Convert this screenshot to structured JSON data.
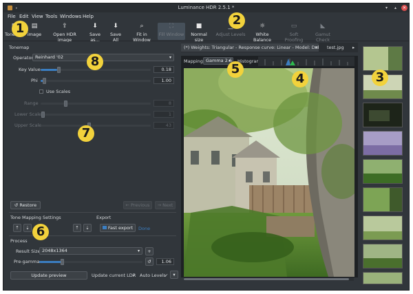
{
  "app": {
    "title": "Luminance HDR 2.5.1 *"
  },
  "menu": [
    "File",
    "Edit",
    "View",
    "Tools",
    "Windows",
    "Help"
  ],
  "toolbar": [
    {
      "label": "Tonemap",
      "icon": "tonemap-icon",
      "enabled": true
    },
    {
      "label": "image",
      "icon": "open-image-icon",
      "enabled": true
    },
    {
      "label": "Open HDR image",
      "icon": "open-hdr-icon",
      "enabled": true
    },
    {
      "label": "Save as...",
      "icon": "save-as-icon",
      "enabled": true
    },
    {
      "label": "Save All",
      "icon": "save-all-icon",
      "enabled": true
    },
    {
      "label": "Fit in Window",
      "icon": "fit-window-icon",
      "enabled": true
    },
    {
      "label": "Fill Window",
      "icon": "fill-window-icon",
      "enabled": false
    },
    {
      "label": "Normal size",
      "icon": "normal-size-icon",
      "enabled": true
    },
    {
      "label": "Adjust Levels",
      "icon": "adjust-levels-icon",
      "enabled": false
    },
    {
      "label": "White Balance",
      "icon": "white-balance-icon",
      "enabled": true
    },
    {
      "label": "Soft Proofing",
      "icon": "soft-proofing-icon",
      "enabled": false
    },
    {
      "label": "Gamut Check",
      "icon": "gamut-check-icon",
      "enabled": false
    }
  ],
  "tonemap": {
    "heading": "Tonemap",
    "operator_label": "Operator",
    "operator": "Reinhard '02",
    "key_value_label": "Key Value",
    "key_value": "0.18",
    "phi_label": "Phi",
    "phi": "1.00",
    "use_scales_label": "Use Scales",
    "range_label": "Range",
    "range": "8",
    "lower_scale_label": "Lower Scale",
    "lower_scale": "1",
    "upper_scale_label": "Upper Scale",
    "upper_scale": "43",
    "restore": "Restore",
    "previous": "Previous",
    "next": "Next"
  },
  "settings": {
    "tone_mapping_settings": "Tone Mapping Settings",
    "export_heading": "Export",
    "fast_export": "Fast export",
    "done": "Done"
  },
  "process": {
    "heading": "Process",
    "result_size_label": "Result Size",
    "result_size": "2048x1364",
    "pregamma_label": "Pre-gamma",
    "pregamma": "1.06",
    "update_preview": "Update preview",
    "update_ldr": "Update current LDR",
    "auto_levels": "Auto Levels"
  },
  "tabs": [
    {
      "label": "(*) Weights: Triangular - Response curve: Linear - Model: Debevec",
      "active": true
    },
    {
      "label": "test.jpg",
      "active": false
    }
  ],
  "viewer": {
    "mapping_label": "Mapping:",
    "mapping": "Gamma 2.6",
    "histogram_label": "Histogram:"
  },
  "callouts": [
    "1",
    "2",
    "3",
    "4",
    "5",
    "6",
    "7",
    "8"
  ],
  "colors": {
    "accent": "#3b7ec2",
    "callout": "#f2d23c",
    "background": "#31363b"
  }
}
